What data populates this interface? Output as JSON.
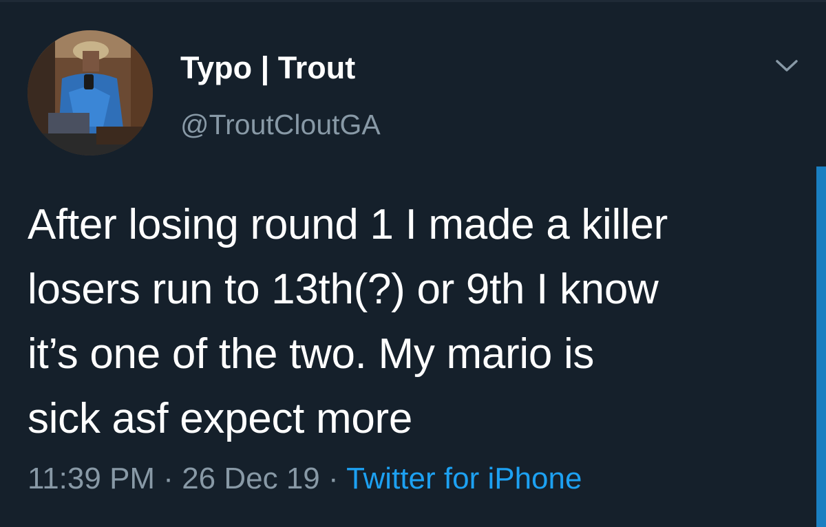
{
  "author": {
    "name": "Typo | Trout",
    "handle": "@TroutCloutGA"
  },
  "tweet": {
    "text": "After losing round 1 I made a killer\nlosers run to 13th(?) or 9th I know\nit’s one of the two. My mario is\nsick asf expect more"
  },
  "meta": {
    "time": "11:39 PM",
    "separator": " · ",
    "date": "26 Dec 19",
    "source": "Twitter for iPhone"
  },
  "icons": {
    "more": "chevron-down-icon",
    "avatar": "profile-photo"
  },
  "colors": {
    "background": "#15202b",
    "primary_text": "#ffffff",
    "secondary_text": "#8899a6",
    "link": "#1da1f2"
  }
}
